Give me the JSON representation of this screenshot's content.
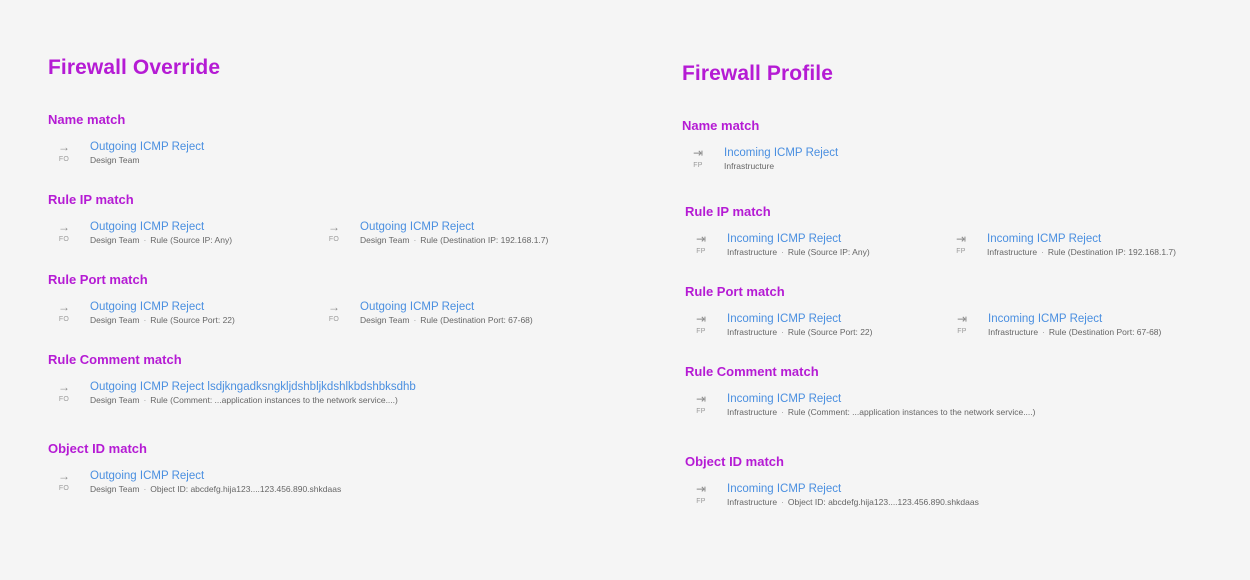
{
  "colors": {
    "heading": "#b51bd4",
    "link": "#4a8fe0",
    "meta": "#666666",
    "icon": "#8c8c8c",
    "background": "#f5f5f5"
  },
  "override": {
    "title": "Firewall Override",
    "icon": "arrow-right-icon",
    "sections": [
      {
        "title": "Name match",
        "items": [
          {
            "link": "Outgoing ICMP Reject",
            "tag": "FO",
            "team": "Design Team",
            "detail": ""
          }
        ]
      },
      {
        "title": "Rule IP match",
        "items": [
          {
            "link": "Outgoing ICMP Reject",
            "tag": "FO",
            "team": "Design Team",
            "detail": "Rule (Source IP: Any)"
          },
          {
            "link": "Outgoing ICMP Reject",
            "tag": "FO",
            "team": "Design Team",
            "detail": "Rule (Destination IP: 192.168.1.7)"
          }
        ]
      },
      {
        "title": "Rule Port match",
        "items": [
          {
            "link": "Outgoing ICMP Reject",
            "tag": "FO",
            "team": "Design Team",
            "detail": "Rule (Source Port: 22)"
          },
          {
            "link": "Outgoing ICMP Reject",
            "tag": "FO",
            "team": "Design Team",
            "detail": "Rule (Destination Port: 67-68)"
          }
        ]
      },
      {
        "title": "Rule Comment match",
        "items": [
          {
            "link": "Outgoing ICMP Reject lsdjkngadksngkljdshbljkdshlkbdshbksdhb",
            "tag": "FO",
            "team": "Design Team",
            "detail": "Rule (Comment: ...application instances to the network service....)"
          }
        ]
      },
      {
        "title": "Object ID match",
        "items": [
          {
            "link": "Outgoing ICMP Reject",
            "tag": "FO",
            "team": "Design Team",
            "detail": "Object ID: abcdefg.hija123....123.456.890.shkdaas"
          }
        ]
      }
    ]
  },
  "profile": {
    "title": "Firewall Profile",
    "icon": "arrow-to-end-icon",
    "sections": [
      {
        "title": "Name match",
        "items": [
          {
            "link": "Incoming ICMP Reject",
            "tag": "FP",
            "team": "Infrastructure",
            "detail": ""
          }
        ]
      },
      {
        "title": "Rule IP match",
        "items": [
          {
            "link": "Incoming ICMP Reject",
            "tag": "FP",
            "team": "Infrastructure",
            "detail": "Rule (Source IP: Any)"
          },
          {
            "link": "Incoming ICMP Reject",
            "tag": "FP",
            "team": "Infrastructure",
            "detail": "Rule (Destination IP: 192.168.1.7)"
          }
        ]
      },
      {
        "title": "Rule Port match",
        "items": [
          {
            "link": "Incoming ICMP Reject",
            "tag": "FP",
            "team": "Infrastructure",
            "detail": "Rule (Source Port: 22)"
          },
          {
            "link": "Incoming ICMP Reject",
            "tag": "FP",
            "team": "Infrastructure",
            "detail": "Rule (Destination Port: 67-68)"
          }
        ]
      },
      {
        "title": "Rule Comment match",
        "items": [
          {
            "link": "Incoming ICMP Reject",
            "tag": "FP",
            "team": "Infrastructure",
            "detail": "Rule (Comment: ...application instances to the network service....)"
          }
        ]
      },
      {
        "title": "Object ID match",
        "items": [
          {
            "link": "Incoming ICMP Reject",
            "tag": "FP",
            "team": "Infrastructure",
            "detail": "Object ID: abcdefg.hija123....123.456.890.shkdaas"
          }
        ]
      }
    ]
  }
}
